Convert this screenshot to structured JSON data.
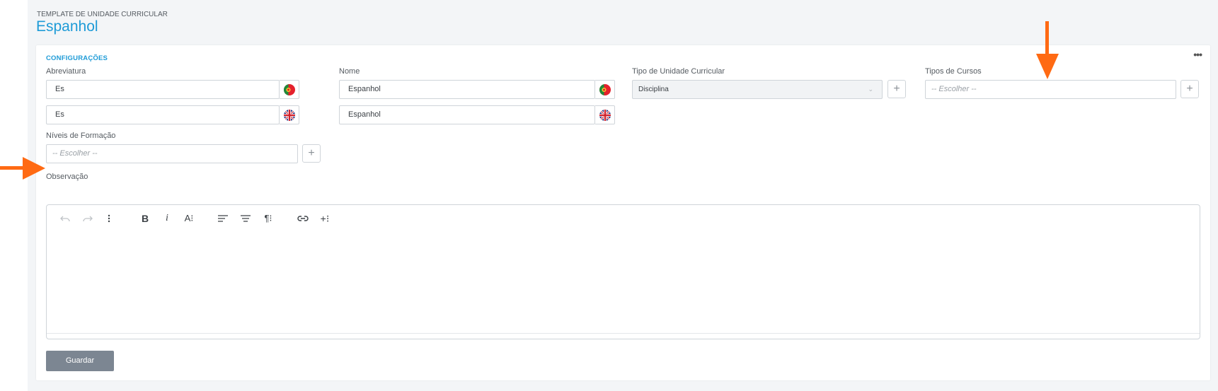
{
  "header": {
    "breadcrumb": "TEMPLATE DE UNIDADE CURRICULAR",
    "title": "Espanhol"
  },
  "card": {
    "title": "CONFIGURAÇÕES",
    "menu": "•••"
  },
  "fields": {
    "abreviatura": {
      "label": "Abreviatura",
      "value_pt": "Es",
      "value_en": "Es"
    },
    "nome": {
      "label": "Nome",
      "value_pt": "Espanhol",
      "value_en": "Espanhol"
    },
    "tipo_uc": {
      "label": "Tipo de Unidade Curricular",
      "value": "Disciplina"
    },
    "tipos_cursos": {
      "label": "Tipos de Cursos",
      "placeholder": "-- Escolher --"
    },
    "niveis": {
      "label": "Níveis de Formação",
      "placeholder": "-- Escolher --"
    },
    "observacao": {
      "label": "Observação"
    }
  },
  "buttons": {
    "plus": "+",
    "save": "Guardar"
  },
  "icons": {
    "flag_pt": "portugal-flag-icon",
    "flag_en": "uk-flag-icon",
    "toolbar": [
      "undo-icon",
      "redo-icon",
      "more-vertical-icon",
      "bold-icon",
      "italic-icon",
      "font-size-icon",
      "align-left-icon",
      "align-center-icon",
      "paragraph-icon",
      "link-icon",
      "insert-icon"
    ]
  },
  "colors": {
    "accent": "#1e9bd7",
    "annotation_arrow": "#ff6a13",
    "save_button": "#7c8692"
  }
}
